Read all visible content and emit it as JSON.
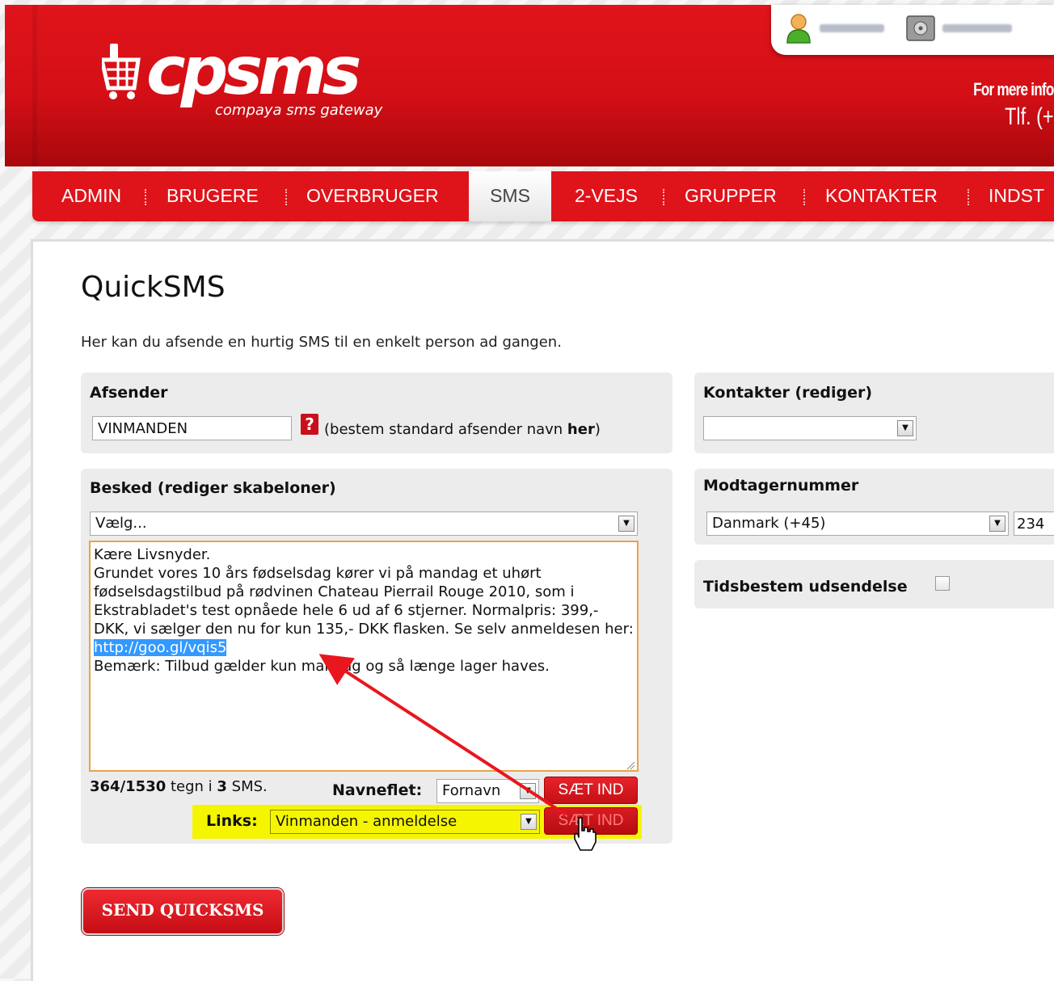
{
  "logo": {
    "brand": "cpsms",
    "tagline": "compaya sms gateway",
    "icon": "cart-phone-logo"
  },
  "header": {
    "user_icon": "user-icon",
    "account_icon": "safe-icon",
    "info_line1": "For mere info",
    "info_line2": "Tlf. (+"
  },
  "nav": {
    "items": [
      "ADMIN",
      "BRUGERE",
      "OVERBRUGER",
      "SMS",
      "2-VEJS",
      "GRUPPER",
      "KONTAKTER",
      "INDST"
    ],
    "active": "SMS"
  },
  "page": {
    "title": "QuickSMS",
    "description": "Her kan du afsende en hurtig SMS til en enkelt person ad gangen."
  },
  "sender": {
    "label": "Afsender",
    "value": "VINMANDEN",
    "help_icon": "question-icon",
    "hint_prefix": "(bestem standard afsender navn ",
    "hint_link": "her",
    "hint_suffix": ")"
  },
  "message": {
    "label": "Besked (rediger skabeloner)",
    "template_select": "Vælg...",
    "text_before": "Kære Livsnyder.\nGrundet vores 10 års fødselsdag kører vi på mandag et uhørt fødselsdagstilbud på rødvinen Chateau Pierrail Rouge 2010, som i Ekstrabladet's test opnåede hele 6 ud af 6 stjerner. Normalpris: 399,- DKK, vi sælger den nu for kun 135,- DKK flasken. Se selv anmeldesen her: ",
    "text_selected": "http://goo.gl/vqis5",
    "text_after": "\nBemærk: Tilbud gælder kun mandag og så længe lager haves.",
    "count": "364/1530",
    "count_mid": " tegn i ",
    "sms_count": "3",
    "sms_suffix": " SMS.",
    "merge_label": "Navneflet:",
    "merge_value": "Fornavn",
    "insert_label": "SÆT IND",
    "links_label": "Links:",
    "links_value": "Vinmanden - anmeldelse",
    "links_insert_label": "SÆT IND"
  },
  "contacts": {
    "label": "Kontakter (rediger)",
    "value": ""
  },
  "recipient": {
    "label": "Modtagernummer",
    "country": "Danmark (+45)",
    "number": "234"
  },
  "schedule": {
    "label": "Tidsbestem udsendelse",
    "checked": false
  },
  "send_label": "SEND QUICKSMS",
  "colors": {
    "brand_red": "#df131a",
    "highlight_yellow": "#f5f500",
    "selection_blue": "#3399ff"
  }
}
